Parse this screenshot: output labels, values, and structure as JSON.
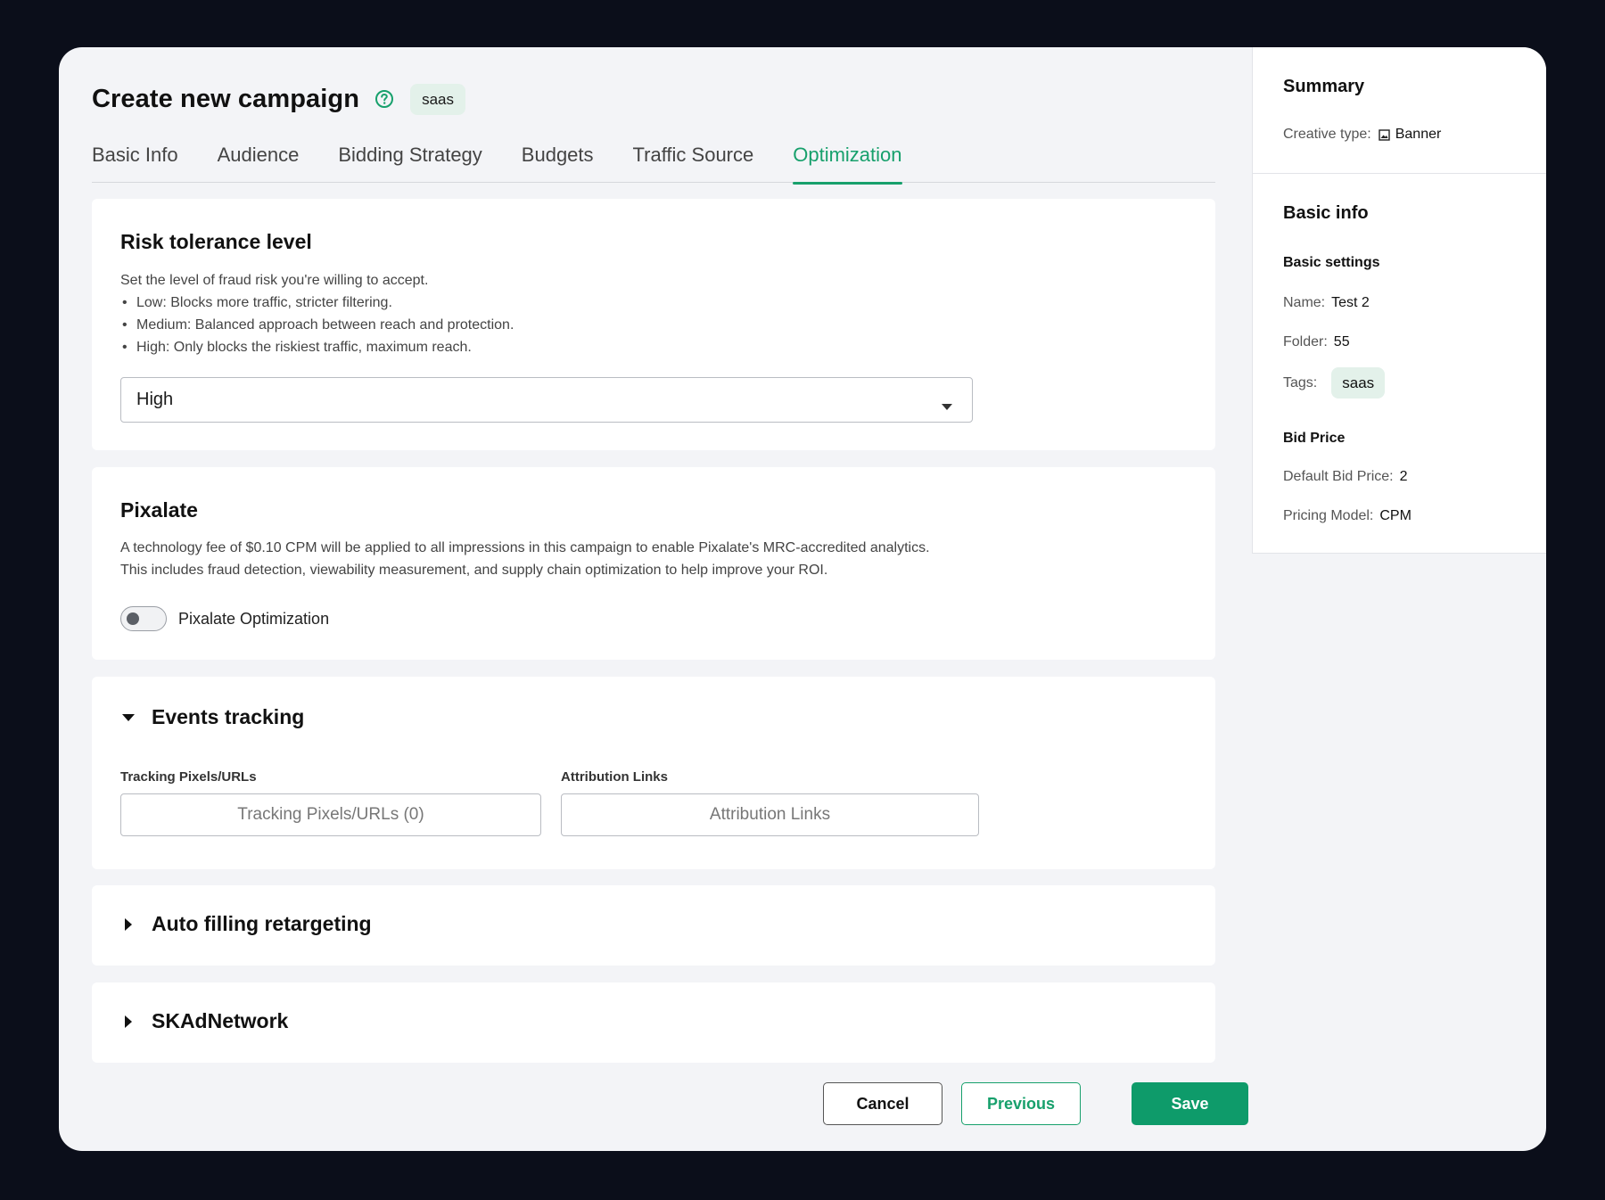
{
  "header": {
    "title": "Create new campaign",
    "tag": "saas"
  },
  "tabs": [
    {
      "label": "Basic Info",
      "active": false
    },
    {
      "label": "Audience",
      "active": false
    },
    {
      "label": "Bidding Strategy",
      "active": false
    },
    {
      "label": "Budgets",
      "active": false
    },
    {
      "label": "Traffic Source",
      "active": false
    },
    {
      "label": "Optimization",
      "active": true
    }
  ],
  "risk": {
    "title": "Risk tolerance level",
    "intro": "Set the level of fraud risk you're willing to accept.",
    "bullets": [
      "Low: Blocks more traffic, stricter filtering.",
      "Medium: Balanced approach between reach and protection.",
      "High: Only blocks the riskiest traffic, maximum reach."
    ],
    "selected": "High"
  },
  "pixalate": {
    "title": "Pixalate",
    "line1": "A technology fee of $0.10 CPM will be applied to all impressions in this campaign to enable Pixalate's MRC-accredited analytics.",
    "line2": "This includes fraud detection, viewability measurement, and supply chain optimization to help improve your ROI.",
    "toggle_label": "Pixalate Optimization",
    "toggle_on": false
  },
  "events": {
    "title": "Events tracking",
    "expanded": true,
    "tracking_label": "Tracking Pixels/URLs",
    "tracking_button": "Tracking Pixels/URLs (0)",
    "attribution_label": "Attribution Links",
    "attribution_button": "Attribution Links"
  },
  "auto_retargeting": {
    "title": "Auto filling retargeting",
    "expanded": false
  },
  "skadnetwork": {
    "title": "SKAdNetwork",
    "expanded": false
  },
  "footer": {
    "cancel": "Cancel",
    "previous": "Previous",
    "save": "Save"
  },
  "summary": {
    "title": "Summary",
    "creative_type_label": "Creative type:",
    "creative_type_value": "Banner",
    "basic_info_title": "Basic info",
    "basic_settings_title": "Basic settings",
    "name_label": "Name:",
    "name_value": "Test 2",
    "folder_label": "Folder:",
    "folder_value": "55",
    "tags_label": "Tags:",
    "tags_value": "saas",
    "bid_price_title": "Bid Price",
    "default_bid_label": "Default Bid Price:",
    "default_bid_value": "2",
    "pricing_model_label": "Pricing Model:",
    "pricing_model_value": "CPM"
  },
  "colors": {
    "accent": "#17a06c",
    "save_button": "#0e9b6a",
    "tag_bg": "#e3f1ea",
    "backdrop": "#0b0e1a",
    "panel_bg": "#f3f4f7"
  },
  "icons": {
    "help": "help-circle-icon",
    "dropdown": "caret-down-icon",
    "expanded": "triangle-down-icon",
    "collapsed": "triangle-right-icon",
    "creative": "image-icon"
  }
}
